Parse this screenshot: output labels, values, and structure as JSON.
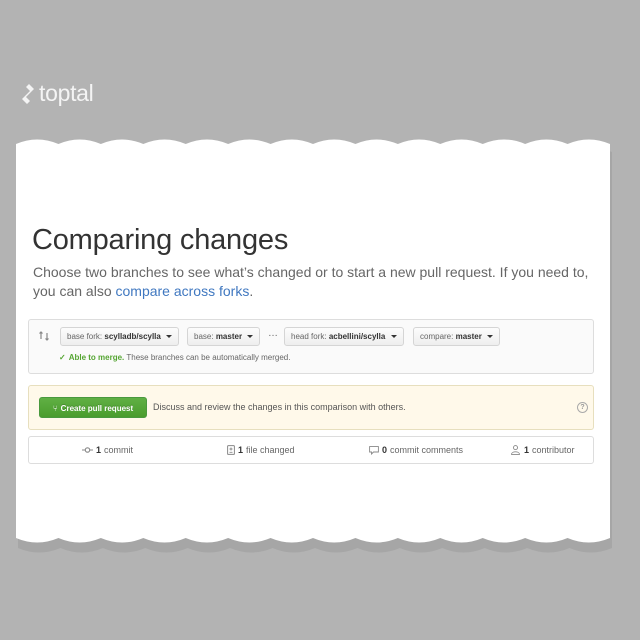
{
  "brand": {
    "logo_text": "toptal",
    "logo_icon": "toptal-diamond-icon"
  },
  "page": {
    "title": "Comparing changes",
    "lead_text": "Choose two branches to see what’s changed or to start a new pull request. If you need to, you can also ",
    "lead_link": "compare across forks",
    "lead_end": "."
  },
  "range": {
    "base_fork_label": "base fork:",
    "base_fork_value": "scylladb/scylla",
    "base_label": "base:",
    "base_value": "master",
    "ellipsis": "…",
    "head_fork_label": "head fork:",
    "head_fork_value": "acbellini/scylla",
    "compare_label": "compare:",
    "compare_value": "master",
    "merge_ok": "Able to merge.",
    "merge_text": "These branches can be automatically merged."
  },
  "flash": {
    "button_label": "Create pull request",
    "text": "Discuss and review the changes in this comparison with others.",
    "help": "?"
  },
  "summary": {
    "commits_count": "1",
    "commits_label": "commit",
    "files_count": "1",
    "files_label": "file changed",
    "comments_count": "0",
    "comments_label": "commit comments",
    "contributors_count": "1",
    "contributors_label": "contributor"
  },
  "colors": {
    "background": "#b3b3b3",
    "paper": "#ffffff",
    "link": "#4078c0",
    "success": "#55a532",
    "button": "#55a532",
    "flash_bg": "#fff9ea"
  }
}
